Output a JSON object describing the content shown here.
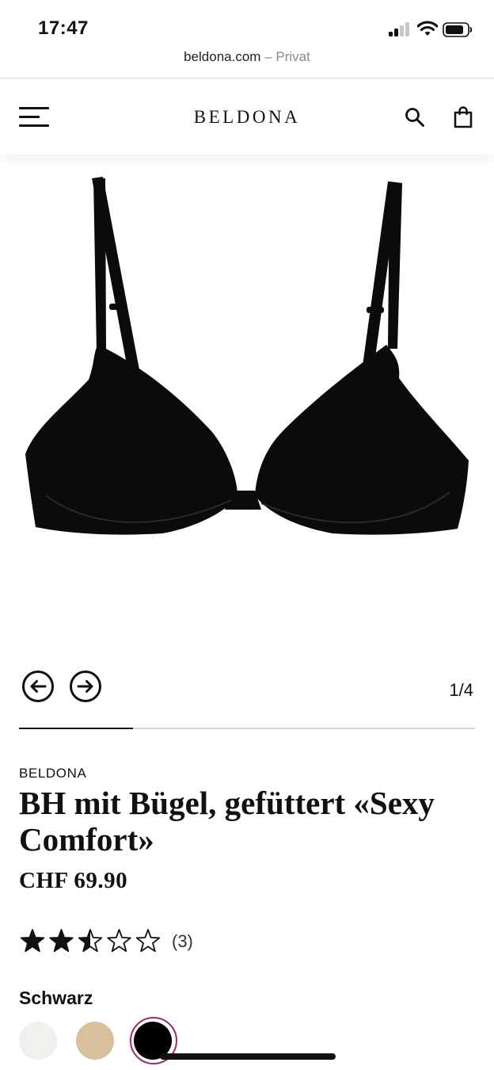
{
  "status_bar": {
    "time": "17:47"
  },
  "browser": {
    "domain": "beldona.com",
    "separator": "–",
    "mode": "Privat"
  },
  "header": {
    "logo": "BELDONA",
    "icons": [
      "menu-icon",
      "search-icon",
      "shopping-bag-icon"
    ]
  },
  "gallery": {
    "current_page": "1/4",
    "progress_fraction": 0.25,
    "icons": [
      "arrow-left-icon",
      "arrow-right-icon"
    ]
  },
  "product": {
    "brand": "BELDONA",
    "title": "BH mit Bügel, gefüttert «Sexy Comfort»",
    "price": "CHF 69.90",
    "rating": 2.5,
    "rating_max": 5,
    "review_count": "(3)",
    "selected_color": "Schwarz",
    "swatches": [
      {
        "name": "swatch-ivory",
        "color": "#f1f0ec"
      },
      {
        "name": "swatch-beige",
        "color": "#d8c09d"
      },
      {
        "name": "swatch-black",
        "color": "#000000",
        "selected": true
      }
    ]
  },
  "colors": {
    "accent_ring": "#9a2c6f",
    "text": "#111111"
  }
}
